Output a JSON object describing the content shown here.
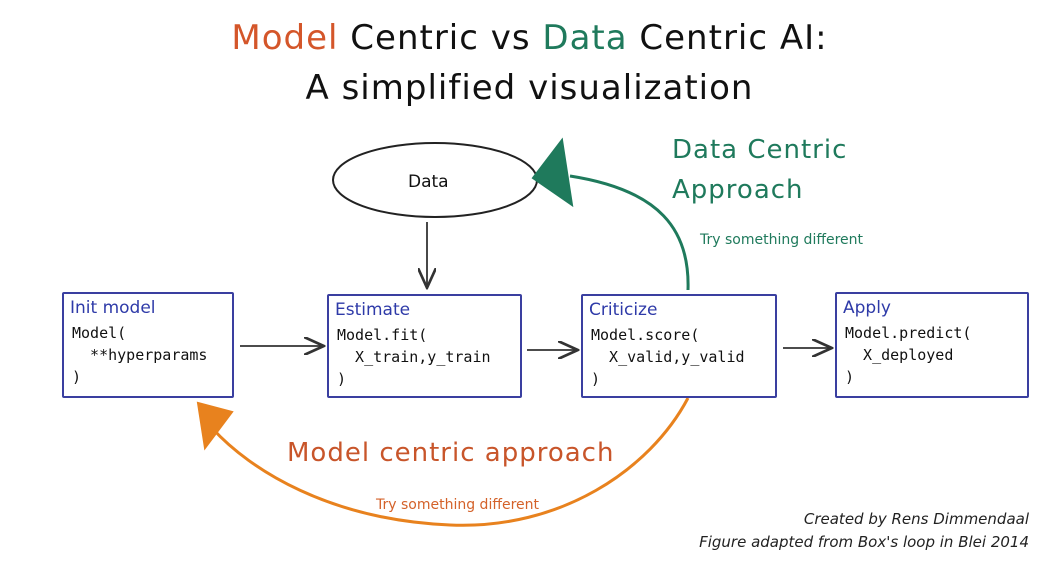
{
  "title": {
    "line1_model": "Model",
    "line1_middle": " Centric vs ",
    "line1_data": "Data",
    "line1_end": " Centric AI:",
    "line2": "A simplified visualization"
  },
  "data_node": {
    "label": "Data"
  },
  "boxes": {
    "init": {
      "title": "Init model",
      "line1": "Model(",
      "line2": "  **hyperparams",
      "line3": ")"
    },
    "estimate": {
      "title": "Estimate",
      "line1": "Model.fit(",
      "line2": "  X_train,y_train",
      "line3": ")"
    },
    "criticize": {
      "title": "Criticize",
      "line1": "Model.score(",
      "line2": "  X_valid,y_valid",
      "line3": ")"
    },
    "apply": {
      "title": "Apply",
      "line1": "Model.predict(",
      "line2": "  X_deployed",
      "line3": ")"
    }
  },
  "data_centric": {
    "line1": "Data Centric",
    "line2": "Approach",
    "sub": "Try something different"
  },
  "model_centric": {
    "label": "Model centric approach",
    "sub": "Try something different"
  },
  "credits": {
    "line1": "Created by Rens Dimmendaal",
    "line2": "Figure adapted from Box's loop in Blei 2014"
  },
  "colors": {
    "model": "#d4562a",
    "data": "#1f7a5c",
    "box_border": "#3a3fa0",
    "orange_arrow": "#e8821e",
    "green_arrow": "#1f7a5c"
  }
}
